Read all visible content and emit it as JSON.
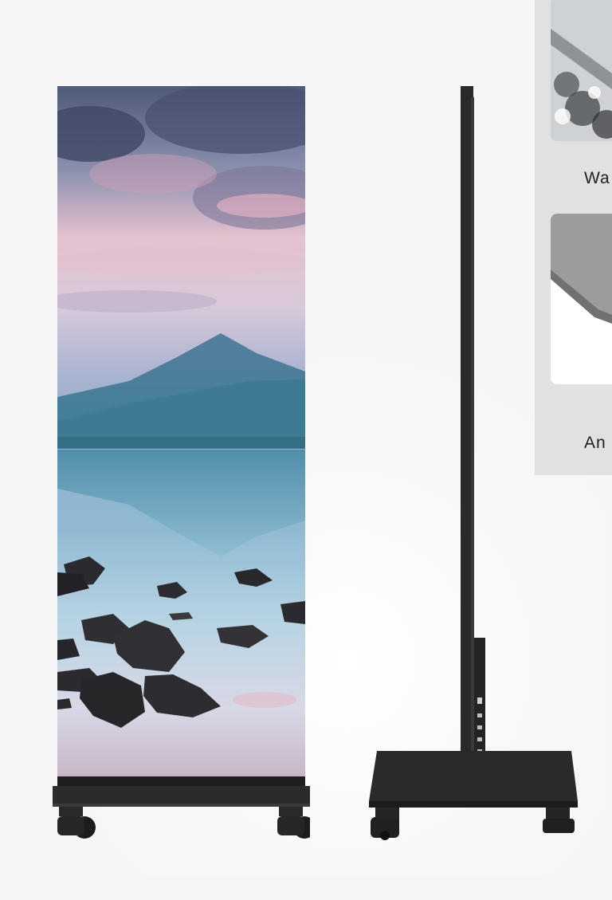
{
  "detail_panel": {
    "labels": [
      "Wa",
      "An"
    ]
  },
  "colors": {
    "background": "#f6f6f6",
    "panel": "#e1e1e1",
    "cabinet": "#262626",
    "sky_top": "#5d6580",
    "sky_pink": "#e7b9c5",
    "mountain": "#4d87a0",
    "water": "#9ec4d8",
    "rock": "#2c2c30"
  },
  "icons": [
    "caster-wheel-icon",
    "power-port-icon"
  ]
}
